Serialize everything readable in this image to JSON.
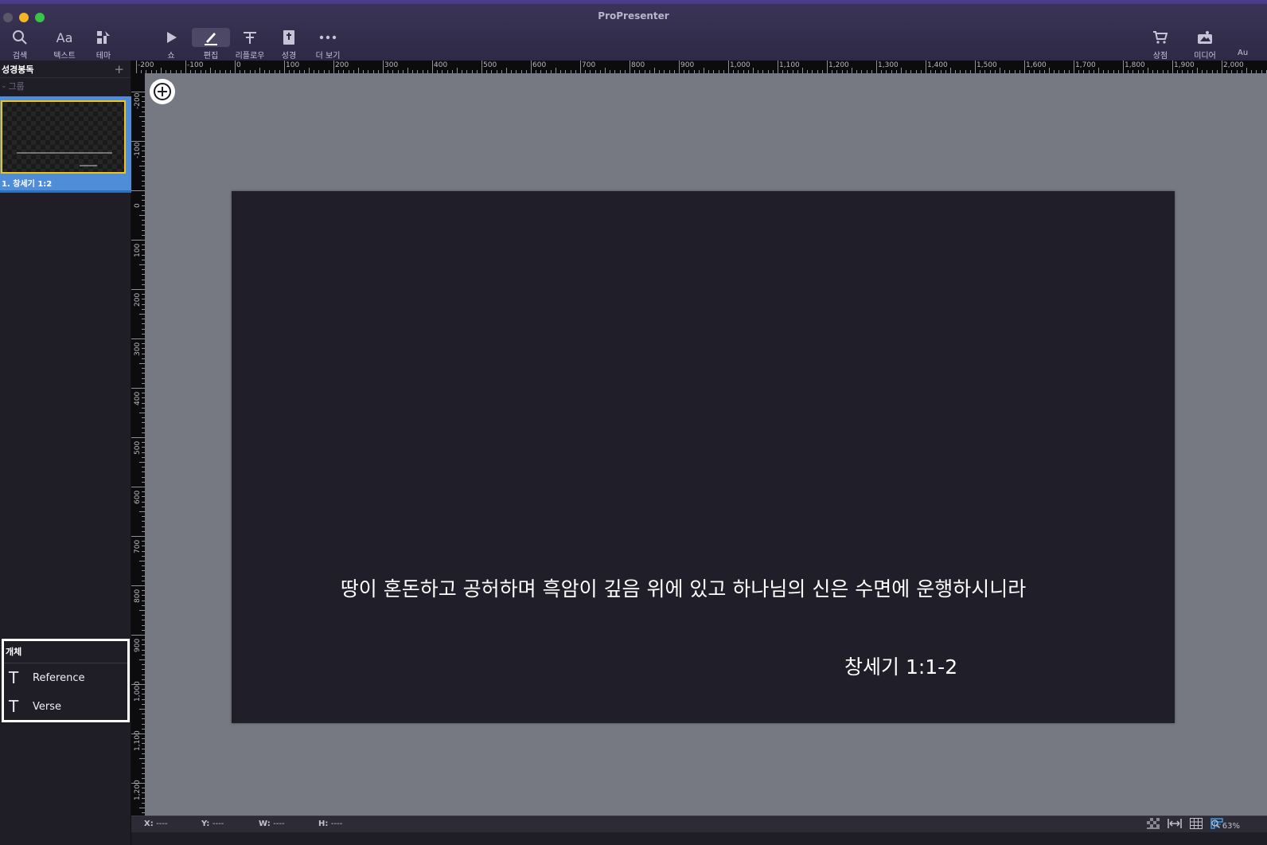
{
  "app": {
    "title": "ProPresenter"
  },
  "toolbar": {
    "search": "검색",
    "text": "텍스트",
    "text_icon_glyph": "Aa",
    "theme": "테마",
    "show": "쇼",
    "edit": "편집",
    "reflow": "리플로우",
    "bible": "성경",
    "more": "더 보기",
    "store": "상점",
    "media": "미디어",
    "audio_truncated": "Au"
  },
  "sidebar": {
    "title": "성경봉독",
    "group_label": "그룹",
    "slide": {
      "label": "1.  창세기 1:2"
    }
  },
  "objects_panel": {
    "title": "개체",
    "items": [
      {
        "glyph": "T",
        "name": "Reference"
      },
      {
        "glyph": "T",
        "name": "Verse"
      }
    ]
  },
  "slide_content": {
    "verse": "땅이 혼돈하고 공허하며 흑암이 깊음 위에 있고 하나님의 신은 수면에 운행하시니라",
    "reference": "창세기 1:1-2"
  },
  "ruler": {
    "horizontal": [
      "-200",
      "-100",
      "0",
      "100",
      "200",
      "300",
      "400",
      "500",
      "600",
      "700",
      "800",
      "900",
      "1,000",
      "1,100",
      "1,200",
      "1,300",
      "1,400",
      "1,500",
      "1,600",
      "1,700",
      "1,800",
      "1,900",
      "2,000"
    ],
    "vertical": [
      "-200",
      "-100",
      "0",
      "100",
      "200",
      "300",
      "400",
      "500",
      "600",
      "700",
      "800",
      "900",
      "1,000",
      "1,100",
      "1,200"
    ]
  },
  "statusbar": {
    "x_label": "X:",
    "x_value": "----",
    "y_label": "Y:",
    "y_value": "----",
    "w_label": "W:",
    "w_value": "----",
    "h_label": "H:",
    "h_value": "----",
    "zoom": "63%"
  },
  "colors": {
    "accent_selection": "#4f8dd8",
    "thumb_highlight": "#f0c419",
    "canvas_bg": "#767981",
    "slide_bg": "#201f29"
  }
}
